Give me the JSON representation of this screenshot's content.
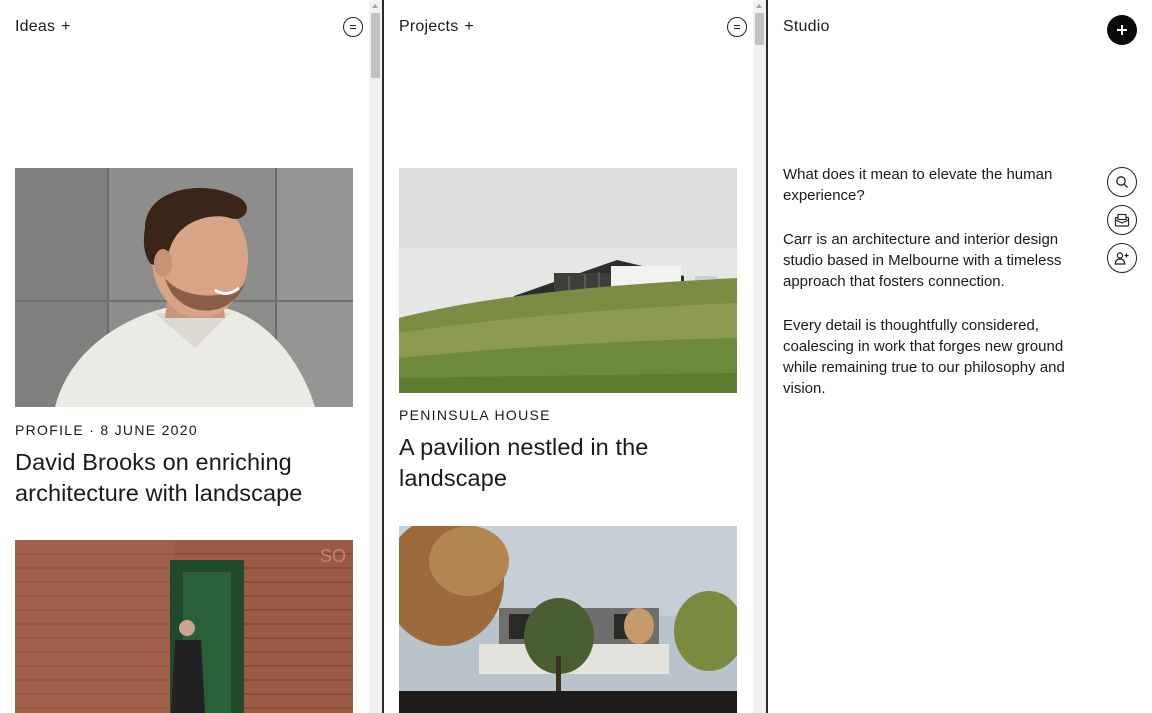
{
  "ideas": {
    "title": "Ideas",
    "plus": "+",
    "card1": {
      "meta": "PROFILE · 8 JUNE 2020",
      "title": "David Brooks on enriching architecture with landscape"
    }
  },
  "projects": {
    "title": "Projects",
    "plus": "+",
    "card1": {
      "meta": "PENINSULA HOUSE",
      "title": "A pavilion nestled in the landscape"
    }
  },
  "studio": {
    "title": "Studio",
    "paragraphs": [
      "What does it mean to elevate the human experience?",
      "Carr is an architecture and interior design studio based in Melbourne with a timeless approach that fosters connection.",
      "Every detail is thoughtfully considered, coalescing in work that forges new ground while remaining true to our philosophy and vision."
    ]
  },
  "icons": [
    "menu-icon",
    "plus-icon",
    "search-icon",
    "mail-icon",
    "add-user-icon"
  ],
  "colors": {
    "text": "#1a1a1a",
    "divider": "#2a2a2a",
    "button": "#0a0a0a"
  }
}
